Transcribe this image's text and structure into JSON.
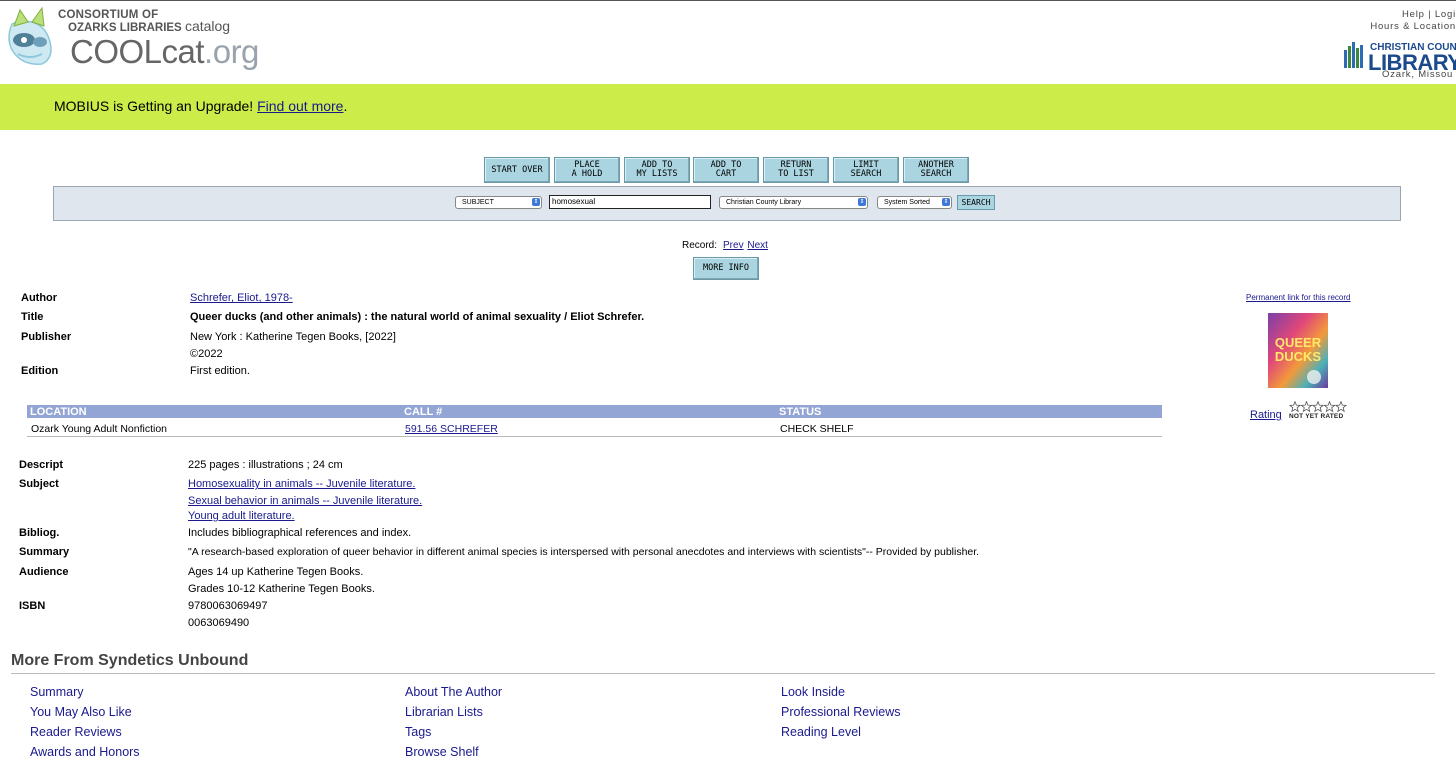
{
  "header": {
    "consortium": "CONSORTIUM OF",
    "ozarks": "OZARKS LIBRARIES",
    "catalog": "catalog",
    "brand_main": "COOLcat",
    "brand_tld": ".org",
    "help_line1": "Help | Logi",
    "help_line2": "Hours & Location",
    "library_top": "CHRISTIAN COUNTY",
    "library_main": "LIBRARY",
    "library_city": "Ozark, Missou"
  },
  "banner": {
    "text": "MOBIUS is Getting an Upgrade! ",
    "link": "Find out more",
    "end": "."
  },
  "nav": {
    "start_over": "START OVER",
    "place_hold": "PLACE\nA HOLD",
    "add_lists": "ADD TO\nMY LISTS",
    "add_cart": "ADD TO\nCART",
    "return_list": "RETURN\nTO LIST",
    "limit_search": "LIMIT\nSEARCH",
    "another_search": "ANOTHER\nSEARCH"
  },
  "search": {
    "type": "SUBJECT",
    "query": "homosexual",
    "scope": "Christian County Library",
    "sort": "System Sorted",
    "button": "SEARCH"
  },
  "record_nav": {
    "label": "Record:",
    "prev": "Prev",
    "next": "Next",
    "more_info": "MORE INFO"
  },
  "bib": {
    "author_label": "Author",
    "author": "Schrefer, Eliot, 1978-",
    "title_label": "Title",
    "title": "Queer ducks (and other animals) : the natural world of animal sexuality / Eliot Schrefer.",
    "publisher_label": "Publisher",
    "publisher": "New York : Katherine Tegen Books, [2022]",
    "copyright": "©2022",
    "edition_label": "Edition",
    "edition": "First edition."
  },
  "holdings": {
    "headers": [
      "LOCATION",
      "CALL #",
      "STATUS"
    ],
    "rows": [
      {
        "location": "Ozark Young Adult Nonfiction",
        "call": "591.56 SCHREFER",
        "status": "CHECK SHELF"
      }
    ]
  },
  "side": {
    "permalink": "Permanent link for this record",
    "cover_title": "QUEER DUCKS",
    "rating": "Rating",
    "not_rated": "NOT YET RATED",
    "rating_value": 0,
    "rating_max": 5
  },
  "details": {
    "descript_label": "Descript",
    "descript": "225 pages : illustrations ; 24 cm",
    "subject_label": "Subject",
    "subjects": [
      "Homosexuality in animals -- Juvenile literature.",
      "Sexual behavior in animals -- Juvenile literature.",
      "Young adult literature."
    ],
    "bibliog_label": "Bibliog.",
    "bibliog": "Includes bibliographical references and index.",
    "summary_label": "Summary",
    "summary": "\"A research-based exploration of queer behavior in different animal species is interspersed with personal anecdotes and interviews with scientists\"-- Provided by publisher.",
    "audience_label": "Audience",
    "audience": [
      "Ages 14 up Katherine Tegen Books.",
      "Grades 10-12 Katherine Tegen Books."
    ],
    "isbn_label": "ISBN",
    "isbn": [
      "9780063069497",
      "0063069490"
    ]
  },
  "syndetics": {
    "title": "More From Syndetics Unbound",
    "col1": [
      "Summary",
      "You May Also Like",
      "Reader Reviews",
      "Awards and Honors"
    ],
    "col2": [
      "About The Author",
      "Librarian Lists",
      "Tags",
      "Browse Shelf"
    ],
    "col3": [
      "Look Inside",
      "Professional Reviews",
      "Reading Level"
    ]
  },
  "colors": {
    "banner": "#ccec4a",
    "nav_button": "#a9d4e0",
    "holdings_header": "#93a5d4",
    "link": "#1a1a8c"
  }
}
